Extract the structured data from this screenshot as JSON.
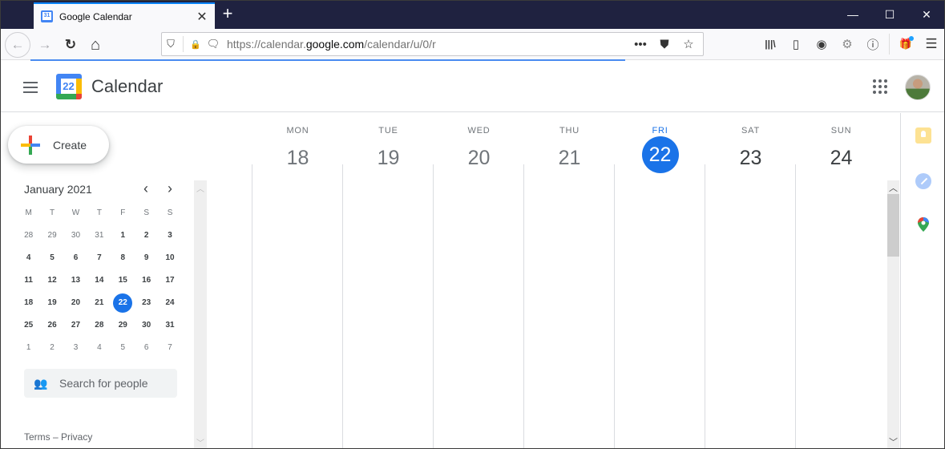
{
  "browser": {
    "tab_title": "Google Calendar",
    "tab_close_glyph": "✕",
    "new_tab_glyph": "+",
    "window_controls": {
      "minimize": "—",
      "maximize": "☐",
      "close": "✕"
    },
    "url_scheme": "https://calendar.",
    "url_host": "google.com",
    "url_path": "/calendar/u/0/r",
    "icons": {
      "back": "←",
      "forward": "→",
      "reload": "↻",
      "home": "⌂",
      "shield": "⛉",
      "lock": "🔒",
      "permissions": "🗨",
      "page_actions": "•••",
      "pocket": "⛊",
      "bookmark": "☆",
      "library": "|||\\",
      "sidebar": "▯",
      "account": "◉",
      "extension": "⚙",
      "info": "ⓘ",
      "gift": "🎁",
      "menu": "☰"
    },
    "loading_progress_percent": 65
  },
  "app": {
    "title": "Calendar",
    "logo_day": "22",
    "create_label": "Create"
  },
  "mini_calendar": {
    "month_label": "January 2021",
    "prev_glyph": "‹",
    "next_glyph": "›",
    "weekday_headers": [
      "M",
      "T",
      "W",
      "T",
      "F",
      "S",
      "S"
    ],
    "weeks": [
      [
        {
          "d": "28",
          "out": true
        },
        {
          "d": "29",
          "out": true
        },
        {
          "d": "30",
          "out": true
        },
        {
          "d": "31",
          "out": true
        },
        {
          "d": "1"
        },
        {
          "d": "2"
        },
        {
          "d": "3"
        }
      ],
      [
        {
          "d": "4"
        },
        {
          "d": "5"
        },
        {
          "d": "6"
        },
        {
          "d": "7"
        },
        {
          "d": "8"
        },
        {
          "d": "9"
        },
        {
          "d": "10"
        }
      ],
      [
        {
          "d": "11"
        },
        {
          "d": "12"
        },
        {
          "d": "13"
        },
        {
          "d": "14"
        },
        {
          "d": "15"
        },
        {
          "d": "16"
        },
        {
          "d": "17"
        }
      ],
      [
        {
          "d": "18"
        },
        {
          "d": "19"
        },
        {
          "d": "20"
        },
        {
          "d": "21"
        },
        {
          "d": "22",
          "today": true
        },
        {
          "d": "23"
        },
        {
          "d": "24"
        }
      ],
      [
        {
          "d": "25"
        },
        {
          "d": "26"
        },
        {
          "d": "27"
        },
        {
          "d": "28"
        },
        {
          "d": "29"
        },
        {
          "d": "30"
        },
        {
          "d": "31"
        }
      ],
      [
        {
          "d": "1",
          "out": true
        },
        {
          "d": "2",
          "out": true
        },
        {
          "d": "3",
          "out": true
        },
        {
          "d": "4",
          "out": true
        },
        {
          "d": "5",
          "out": true
        },
        {
          "d": "6",
          "out": true
        },
        {
          "d": "7",
          "out": true
        }
      ]
    ]
  },
  "people_search": {
    "placeholder": "Search for people"
  },
  "footer": {
    "terms": "Terms",
    "separator": " – ",
    "privacy": "Privacy"
  },
  "week": {
    "days": [
      {
        "name": "MON",
        "num": "18",
        "state": "past"
      },
      {
        "name": "TUE",
        "num": "19",
        "state": "past"
      },
      {
        "name": "WED",
        "num": "20",
        "state": "past"
      },
      {
        "name": "THU",
        "num": "21",
        "state": "past"
      },
      {
        "name": "FRI",
        "num": "22",
        "state": "today"
      },
      {
        "name": "SAT",
        "num": "23",
        "state": "future"
      },
      {
        "name": "SUN",
        "num": "24",
        "state": "future"
      }
    ]
  },
  "side_panel": [
    "keep-icon",
    "tasks-icon",
    "maps-icon"
  ],
  "colors": {
    "accent": "#1a73e8",
    "tab_strip": "#1f2240"
  }
}
